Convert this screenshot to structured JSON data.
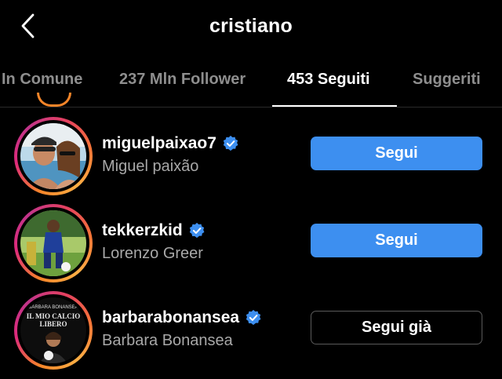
{
  "header": {
    "title": "cristiano",
    "back_icon": "chevron-left-icon"
  },
  "tabs": [
    {
      "label": "In Comune",
      "active": false
    },
    {
      "label": "237 Mln Follower",
      "active": false
    },
    {
      "label": "453 Seguiti",
      "active": true
    },
    {
      "label": "Suggeriti",
      "active": false
    }
  ],
  "accounts": [
    {
      "username": "miguelpaixao7",
      "full_name": "Miguel paixão",
      "verified": true,
      "button": "Segui",
      "following": false
    },
    {
      "username": "tekkerzkid",
      "full_name": "Lorenzo Greer",
      "verified": true,
      "button": "Segui",
      "following": false
    },
    {
      "username": "barbarabonansea",
      "full_name": "Barbara Bonansea",
      "verified": true,
      "button": "Segui già",
      "following": true,
      "avatar_text": {
        "top": "BARBARA BONANSEA",
        "title_line1": "IL MIO CALCIO",
        "title_line2": "LIBERO"
      }
    }
  ],
  "colors": {
    "accent": "#3d8ff0",
    "verified": "#3d8ff0",
    "background": "#000000",
    "secondary_text": "#a8a8a8"
  }
}
